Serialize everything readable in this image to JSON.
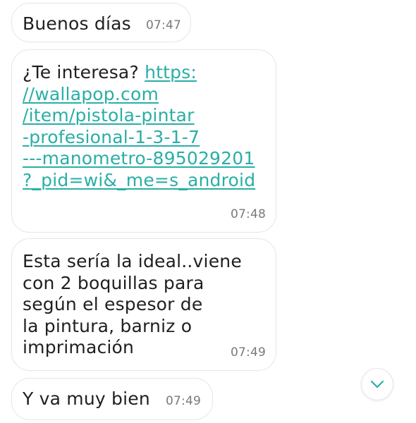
{
  "messages": [
    {
      "text": "Buenos días",
      "time": "07:47"
    },
    {
      "prefix": "¿Te interesa? ",
      "link_lines": [
        "https:",
        "//wallapop.com",
        "/item/pistola-pintar",
        "-profesional-1-3-1-7",
        "---manometro-895029201",
        "?_pid=wi&_me=s_android"
      ],
      "time": "07:48"
    },
    {
      "text": "Esta sería la ideal..viene\ncon 2 boquillas para\nsegún el espesor de\nla pintura, barniz o\nimprimación",
      "time": "07:49"
    },
    {
      "text": "Y va muy bien",
      "time": "07:49"
    }
  ],
  "scroll_button": {
    "icon": "chevron-down-icon"
  },
  "colors": {
    "link": "#2aaea6",
    "bubble_border": "#e6e6e6",
    "text": "#1f1f1f",
    "timestamp": "#7a7a7a",
    "chevron": "#2aaea6"
  }
}
